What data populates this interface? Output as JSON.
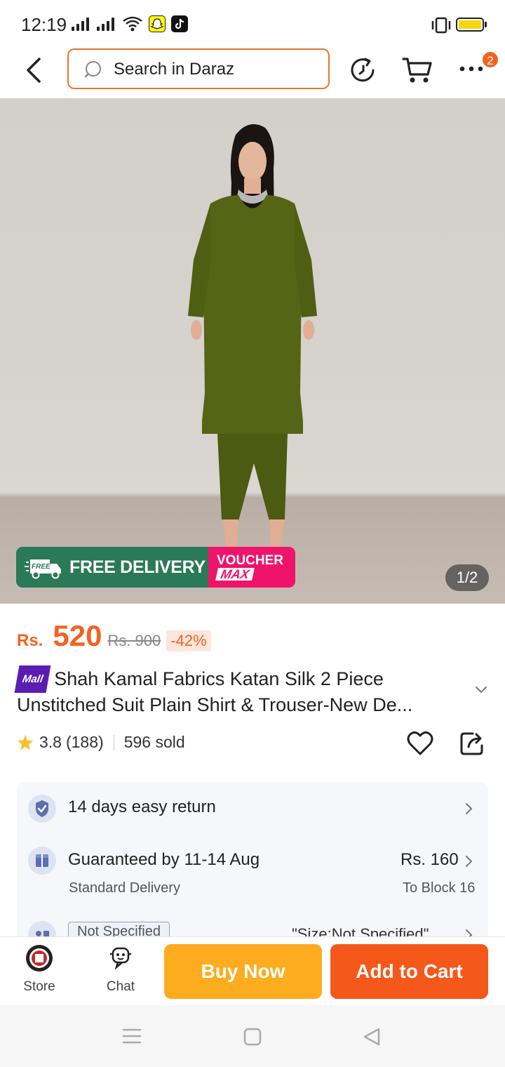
{
  "status": {
    "time": "12:19"
  },
  "header": {
    "search_placeholder": "Search in Daraz",
    "cart_badge": "2"
  },
  "hero": {
    "promo_free_tag": "FREE",
    "promo_free": "FREE DELIVERY",
    "promo_voucher": "VOUCHER",
    "promo_max": "MAX",
    "image_counter": "1/2"
  },
  "product": {
    "currency": "Rs.",
    "price": "520",
    "original_price": "Rs. 900",
    "discount": "-42%",
    "mall_label": "Mall",
    "title_line1": "Shah Kamal Fabrics Katan Silk 2 Piece",
    "title_line2": "Unstitched Suit Plain Shirt & Trouser-New De...",
    "rating": "3.8",
    "rating_count": "(188)",
    "sold": "596 sold"
  },
  "info": {
    "returns": "14 days easy return",
    "delivery_title": "Guaranteed by 11-14 Aug",
    "delivery_sub": "Standard Delivery",
    "delivery_fee": "Rs. 160",
    "delivery_to": "To Block 16",
    "variant_tag": "Not Specified",
    "variant_value": "\"Size:Not Specified\""
  },
  "bottom_bar": {
    "store_label": "Store",
    "chat_label": "Chat",
    "buy_now": "Buy Now",
    "add_to_cart": "Add to Cart"
  },
  "colors": {
    "accent_orange": "#f4621f",
    "buy_now": "#fcac1e",
    "add_to_cart": "#f5581b",
    "free_delivery_green": "#2a7a55",
    "voucher_pink": "#f0136b",
    "mall_purple": "#5b1cb4"
  }
}
